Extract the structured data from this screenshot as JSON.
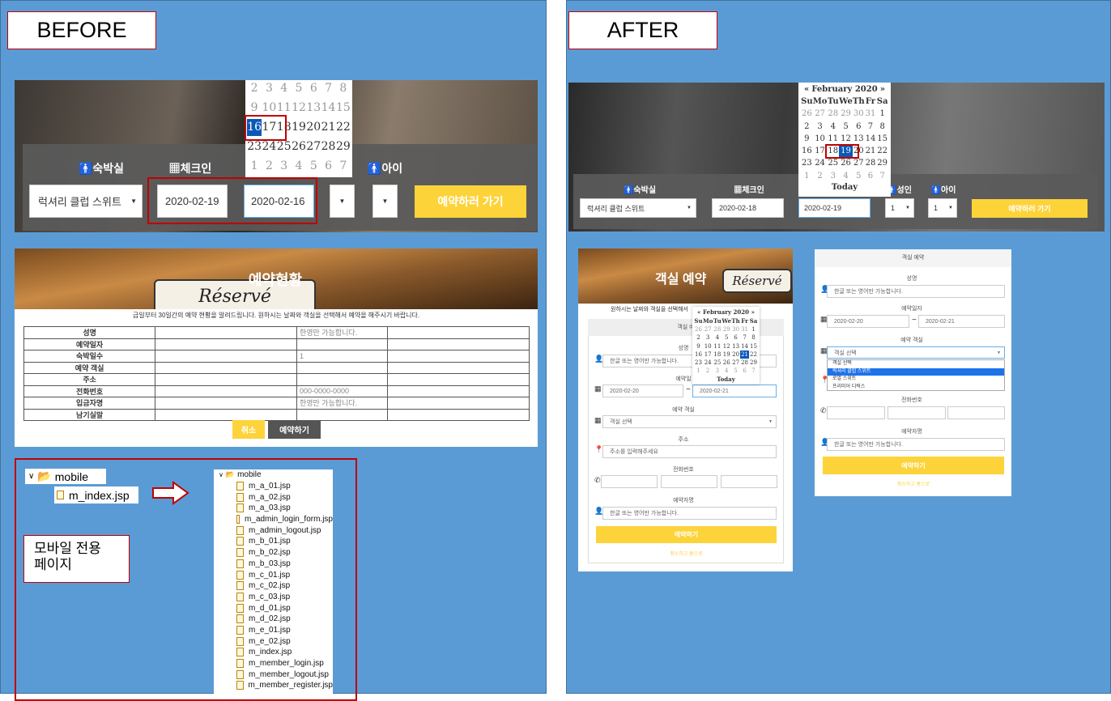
{
  "captions": {
    "before": "BEFORE",
    "after": "AFTER",
    "mobile_note": "모바일 전용\n페이지"
  },
  "before": {
    "search": {
      "labels": {
        "room": "숙박실",
        "checkin": "체크인",
        "child": "아이"
      },
      "room_value": "럭셔리 클럽 스위트",
      "checkin_value": "2020-02-19",
      "checkout_value": "2020-02-16",
      "button": "예약하러 가기"
    },
    "calendar": {
      "rows": [
        [
          "2",
          "3",
          "4",
          "5",
          "6",
          "7",
          "8"
        ],
        [
          "9",
          "10",
          "11",
          "12",
          "13",
          "14",
          "15"
        ],
        [
          "16",
          "17",
          "18",
          "19",
          "20",
          "21",
          "22"
        ],
        [
          "23",
          "24",
          "25",
          "26",
          "27",
          "28",
          "29"
        ],
        [
          "1",
          "2",
          "3",
          "4",
          "5",
          "6",
          "7"
        ]
      ],
      "selected": "16"
    },
    "reservation": {
      "title": "예약현황",
      "intro": "금일부터 30일간의 예약 현황을 알려드립니다. 원하시는 날짜와 객실을 선택해서 예약을 해주시기 바랍니다.",
      "rows": [
        {
          "label": "성명",
          "value": "한영만 가능합니다."
        },
        {
          "label": "예약일자",
          "value": ""
        },
        {
          "label": "숙박일수",
          "value": "1"
        },
        {
          "label": "예약 객실",
          "value": ""
        },
        {
          "label": "주소",
          "value": ""
        },
        {
          "label": "전화번호",
          "value": "000-0000-0000"
        },
        {
          "label": "입금자명",
          "value": "한영만 가능합니다."
        },
        {
          "label": "남기실말",
          "value": ""
        }
      ],
      "cancel": "취소",
      "submit": "예약하기"
    },
    "tree": {
      "folder": "mobile",
      "file": "m_index.jsp"
    },
    "file_list": {
      "folder": "mobile",
      "files": [
        "m_a_01.jsp",
        "m_a_02.jsp",
        "m_a_03.jsp",
        "m_admin_login_form.jsp",
        "m_admin_logout.jsp",
        "m_b_01.jsp",
        "m_b_02.jsp",
        "m_b_03.jsp",
        "m_c_01.jsp",
        "m_c_02.jsp",
        "m_c_03.jsp",
        "m_d_01.jsp",
        "m_d_02.jsp",
        "m_e_01.jsp",
        "m_e_02.jsp",
        "m_index.jsp",
        "m_member_login.jsp",
        "m_member_logout.jsp",
        "m_member_register.jsp"
      ]
    }
  },
  "after": {
    "search": {
      "labels": {
        "room": "숙박실",
        "checkin": "체크인",
        "adult": "성인",
        "child": "아이"
      },
      "room_value": "럭셔리 클럽 스위트",
      "checkin_value": "2020-02-18",
      "checkout_value": "2020-02-19",
      "adult_value": "1",
      "child_value": "1",
      "button": "예약하러 가기"
    },
    "calendar": {
      "prev": "«",
      "next": "»",
      "month": "February 2020",
      "weekdays": [
        "Su",
        "Mo",
        "Tu",
        "We",
        "Th",
        "Fr",
        "Sa"
      ],
      "rows": [
        [
          "26",
          "27",
          "28",
          "29",
          "30",
          "31",
          "1"
        ],
        [
          "2",
          "3",
          "4",
          "5",
          "6",
          "7",
          "8"
        ],
        [
          "9",
          "10",
          "11",
          "12",
          "13",
          "14",
          "15"
        ],
        [
          "16",
          "17",
          "18",
          "19",
          "20",
          "21",
          "22"
        ],
        [
          "23",
          "24",
          "25",
          "26",
          "27",
          "28",
          "29"
        ],
        [
          "1",
          "2",
          "3",
          "4",
          "5",
          "6",
          "7"
        ]
      ],
      "selected": "19",
      "today": "Today"
    },
    "mobile1": {
      "banner": "객실 예약",
      "sign": "Réservé",
      "intro": "원하시는 날짜와 객실을 선택해서",
      "section": "객실 예",
      "name_label": "성명",
      "name_placeholder": "한글 또는 영어만 가능합니다.",
      "date_label": "예약일",
      "date_from": "2020-02-20",
      "date_to": "2020-02-21",
      "room_label": "예약 객실",
      "room_placeholder": "객실 선택",
      "addr_label": "주소",
      "addr_placeholder": "주소를 입력해주세요",
      "phone_label": "전화번호",
      "depositor_label": "예약자명",
      "depositor_placeholder": "한글 또는 영어만 가능합니다.",
      "submit": "예약하기",
      "cancel": "취소하고 홈으로",
      "calendar": {
        "month": "February 2020",
        "prev": "«",
        "next": "»",
        "weekdays": [
          "Su",
          "Mo",
          "Tu",
          "We",
          "Th",
          "Fr",
          "Sa"
        ],
        "rows": [
          [
            "26",
            "27",
            "28",
            "29",
            "30",
            "31",
            "1"
          ],
          [
            "2",
            "3",
            "4",
            "5",
            "6",
            "7",
            "8"
          ],
          [
            "9",
            "10",
            "11",
            "12",
            "13",
            "14",
            "15"
          ],
          [
            "16",
            "17",
            "18",
            "19",
            "20",
            "21",
            "22"
          ],
          [
            "23",
            "24",
            "25",
            "26",
            "27",
            "28",
            "29"
          ],
          [
            "1",
            "2",
            "3",
            "4",
            "5",
            "6",
            "7"
          ]
        ],
        "selected": "21",
        "today": "Today"
      }
    },
    "mobile2": {
      "title": "객실 예약",
      "name_label": "성명",
      "name_placeholder": "한글 또는 영어만 가능합니다.",
      "date_label": "예약일자",
      "date_from": "2020-02-20",
      "date_to": "2020-02-21",
      "room_label": "예약 객실",
      "room_placeholder": "객실 선택",
      "room_options": [
        "객실 선택",
        "럭셔리 클럽 스위트",
        "로열 스위트",
        "프리미어 디럭스"
      ],
      "room_highlight": "럭셔리 클럽 스위트",
      "phone_label": "전화번호",
      "depositor_label": "예약자명",
      "depositor_placeholder": "한글 또는 영어만 가능합니다.",
      "submit": "예약하기",
      "cancel": "취소하고 홈으로"
    }
  },
  "colors": {
    "panel": "#5b9bd5",
    "accent_yellow": "#fdd33a",
    "selected_blue": "#0a59b8",
    "highlight_red": "#c00000"
  }
}
